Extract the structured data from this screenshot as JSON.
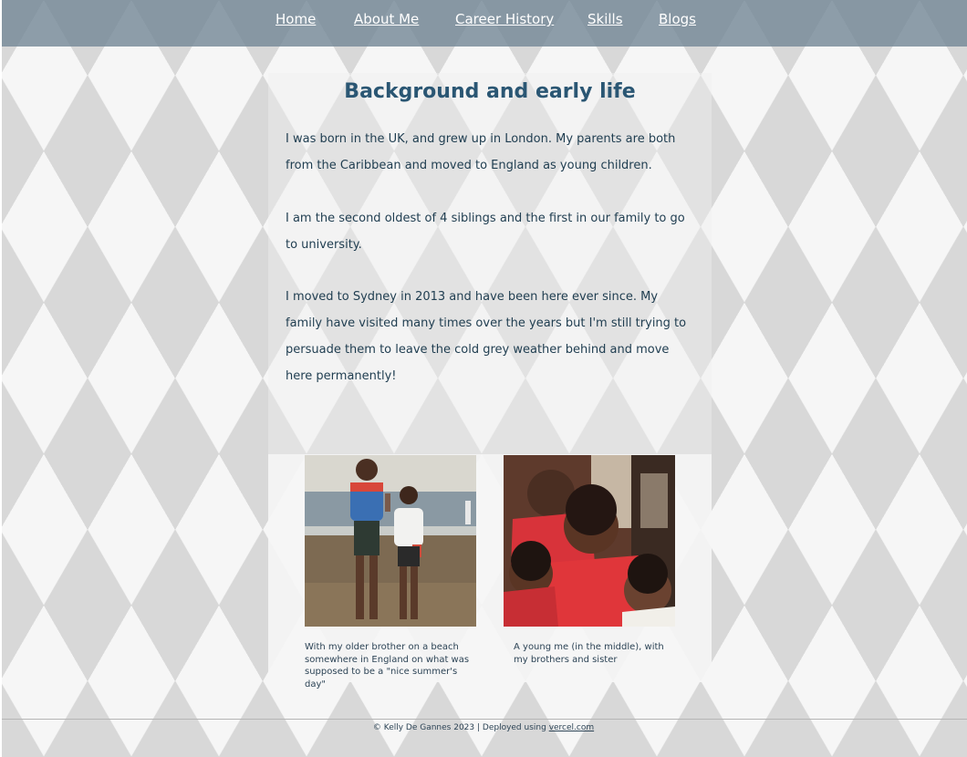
{
  "nav": {
    "items": [
      {
        "label": "Home"
      },
      {
        "label": "About Me"
      },
      {
        "label": "Career History"
      },
      {
        "label": "Skills"
      },
      {
        "label": "Blogs"
      }
    ]
  },
  "main": {
    "heading": "Background and early life",
    "paragraphs": [
      "I was born in the UK, and grew up in London. My parents are both from the Caribbean and moved to England as young children.",
      "I am the second oldest of 4 siblings and the first in our family to go to university.",
      "I moved to Sydney in 2013 and have been here ever since. My family have visited many times over the years but I'm still trying to persuade them to leave the cold grey weather behind and move here permanently!"
    ]
  },
  "gallery": {
    "photos": [
      {
        "caption": "With my older brother on a beach somewhere in England on what was supposed to be a \"nice summer's day\""
      },
      {
        "caption": "A young me (in the middle), with my brothers and sister"
      }
    ]
  },
  "footer": {
    "text": "© Kelly De Gannes 2023 | Deployed using ",
    "link_label": "vercel.com"
  },
  "colors": {
    "nav_background": "#708494",
    "heading": "#2a5673",
    "text": "#1f3d50"
  }
}
